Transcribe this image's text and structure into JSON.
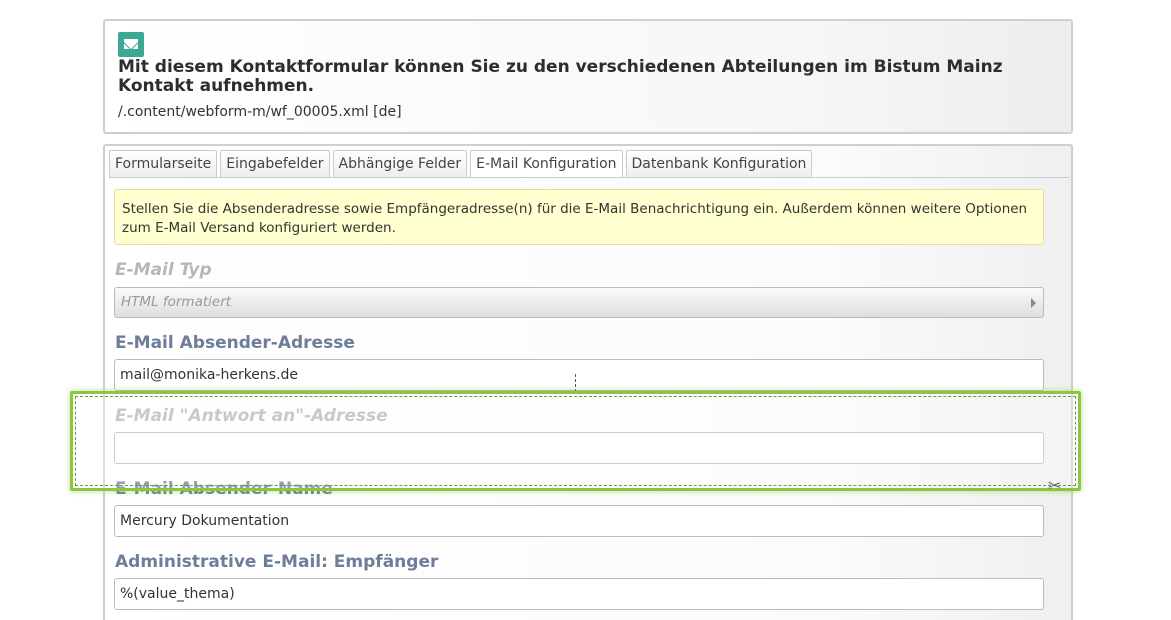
{
  "header": {
    "icon": "mail-icon",
    "title": "Mit diesem Kontaktformular können Sie zu den verschiedenen Abteilungen im Bistum Mainz Kontakt aufnehmen.",
    "path": "/.content/webform-m/wf_00005.xml [de]"
  },
  "tabs": [
    {
      "label": "Formularseite",
      "active": false
    },
    {
      "label": "Eingabefelder",
      "active": false
    },
    {
      "label": "Abhängige Felder",
      "active": false
    },
    {
      "label": "E-Mail Konfiguration",
      "active": true
    },
    {
      "label": "Datenbank Konfiguration",
      "active": false
    }
  ],
  "info": "Stellen Sie die Absenderadresse sowie Empfängeradresse(n) für die E-Mail Benachrichtigung ein. Außerdem können weitere Optionen zum E-Mail Versand konfiguriert werden.",
  "fields": {
    "mail_type": {
      "label": "E-Mail Typ",
      "value": "HTML formatiert"
    },
    "sender_address": {
      "label": "E-Mail Absender-Adresse",
      "value": "mail@monika-herkens.de"
    },
    "reply_to": {
      "label": "E-Mail \"Antwort an\"-Adresse",
      "value": ""
    },
    "sender_name": {
      "label": "E-Mail Absender-Name",
      "value": "Mercury Dokumentation"
    },
    "admin_recipient": {
      "label": "Administrative E-Mail: Empfänger",
      "value": "%(value_thema)"
    }
  },
  "colors": {
    "highlight": "#8cc63f",
    "label": "#6e7d9a",
    "info_bg": "#ffffcf",
    "icon": "#3aa893"
  }
}
